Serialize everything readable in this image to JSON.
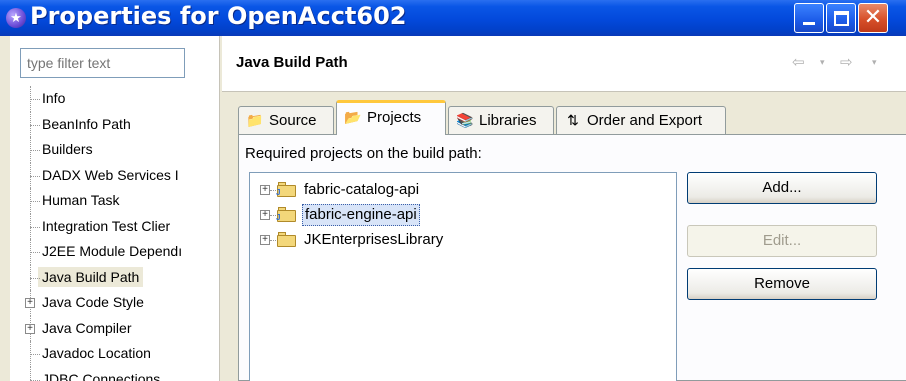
{
  "window": {
    "title": "Properties for OpenAcct602",
    "icon": "eclipse-icon"
  },
  "left": {
    "filter_placeholder": "type filter text",
    "tree": [
      {
        "label": "Info",
        "expandable": false
      },
      {
        "label": "BeanInfo Path",
        "expandable": false
      },
      {
        "label": "Builders",
        "expandable": false
      },
      {
        "label": "DADX Web Services I",
        "expandable": false
      },
      {
        "label": "Human Task",
        "expandable": false
      },
      {
        "label": "Integration Test Clier",
        "expandable": false
      },
      {
        "label": "J2EE Module Dependı",
        "expandable": false
      },
      {
        "label": "Java Build Path",
        "expandable": false,
        "selected": true
      },
      {
        "label": "Java Code Style",
        "expandable": true
      },
      {
        "label": "Java Compiler",
        "expandable": true
      },
      {
        "label": "Javadoc Location",
        "expandable": false
      },
      {
        "label": "JDBC Connections",
        "expandable": false
      }
    ]
  },
  "right": {
    "page_title": "Java Build Path",
    "nav": {
      "back": "⇦",
      "forward": "⇨",
      "dropdown": "▾"
    },
    "tabs": [
      {
        "label": "Source",
        "icon": "source-folder-icon"
      },
      {
        "label": "Projects",
        "icon": "projects-folder-icon",
        "active": true
      },
      {
        "label": "Libraries",
        "icon": "libraries-icon"
      },
      {
        "label": "Order and Export",
        "icon": "order-export-icon"
      }
    ],
    "required_label": "Required projects on the build path:",
    "projects": [
      {
        "name": "fabric-catalog-api",
        "icon": "java-project-icon",
        "selected": false
      },
      {
        "name": "fabric-engine-api",
        "icon": "java-project-icon",
        "selected": true
      },
      {
        "name": "JKEnterprisesLibrary",
        "icon": "folder-icon",
        "selected": false
      }
    ],
    "buttons": {
      "add": "Add...",
      "edit": "Edit...",
      "remove": "Remove"
    }
  }
}
